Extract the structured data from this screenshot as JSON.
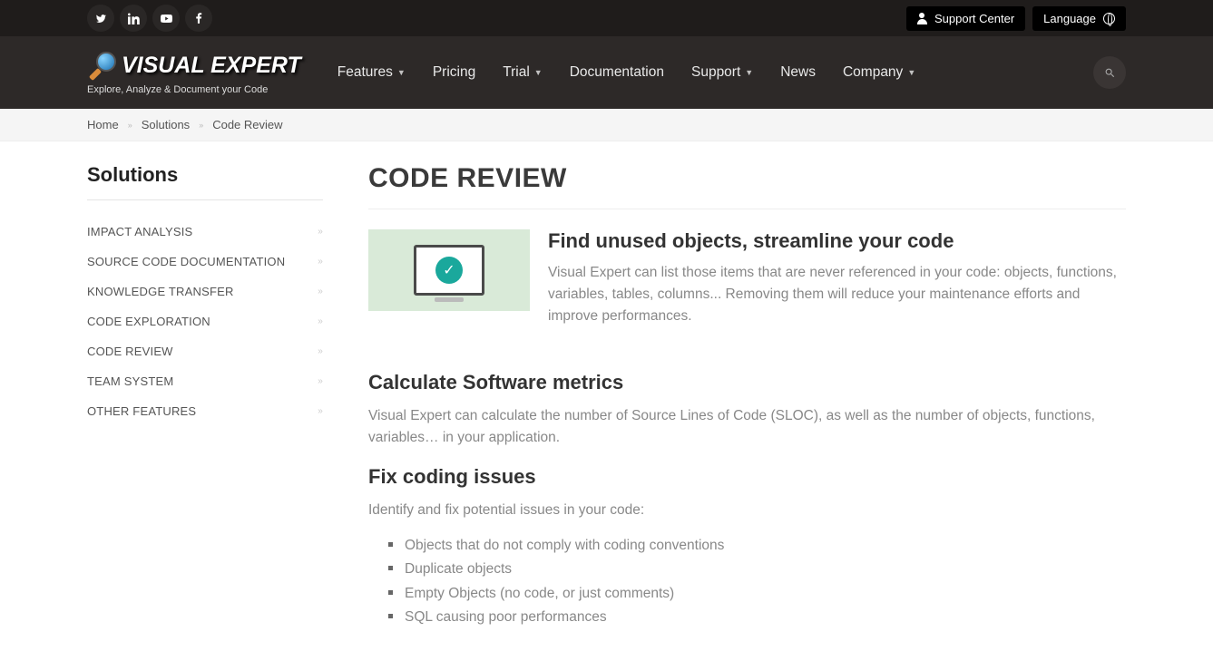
{
  "topbar": {
    "support": "Support Center",
    "language": "Language"
  },
  "brand": {
    "name": "VISUAL EXPERT",
    "tagline": "Explore, Analyze & Document your Code"
  },
  "nav": {
    "features": "Features",
    "pricing": "Pricing",
    "trial": "Trial",
    "documentation": "Documentation",
    "support": "Support",
    "news": "News",
    "company": "Company"
  },
  "breadcrumb": {
    "home": "Home",
    "solutions": "Solutions",
    "current": "Code Review"
  },
  "sidebar": {
    "title": "Solutions",
    "items": [
      "IMPACT ANALYSIS",
      "SOURCE CODE DOCUMENTATION",
      "KNOWLEDGE TRANSFER",
      "CODE EXPLORATION",
      "CODE REVIEW",
      "TEAM SYSTEM",
      "OTHER FEATURES"
    ]
  },
  "page": {
    "title": "CODE REVIEW",
    "sec1_h": "Find unused objects, streamline your code",
    "sec1_p": "Visual Expert can list those items that are never referenced in your code: objects, functions, variables, tables, columns... Removing them will reduce your maintenance efforts and improve performances.",
    "sec2_h": "Calculate Software metrics",
    "sec2_p": "Visual Expert can calculate the number of Source Lines of Code (SLOC), as well as the number of objects, functions, variables… in your application.",
    "sec3_h": "Fix coding issues",
    "sec3_p": "Identify and fix potential issues in your code:",
    "issues": [
      "Objects that do not comply with coding conventions",
      "Duplicate objects",
      "Empty Objects (no code, or just comments)",
      "SQL causing poor performances"
    ]
  }
}
